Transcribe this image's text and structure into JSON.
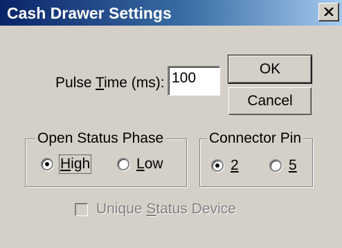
{
  "window": {
    "title": "Cash Drawer Settings"
  },
  "icons": {
    "close": "close-icon"
  },
  "pulse_time": {
    "label_prefix": "Pulse ",
    "label_mnemonic": "T",
    "label_suffix": "ime (ms):",
    "value": "100"
  },
  "buttons": {
    "ok": "OK",
    "cancel": "Cancel"
  },
  "open_status_phase": {
    "legend": "Open Status Phase",
    "options": [
      {
        "mnemonic": "H",
        "rest": "igh",
        "checked": true,
        "focused": true
      },
      {
        "mnemonic": "L",
        "rest": "ow",
        "checked": false,
        "focused": false
      }
    ]
  },
  "connector_pin": {
    "legend": "Connector Pin",
    "options": [
      {
        "mnemonic": "2",
        "rest": "",
        "checked": true
      },
      {
        "mnemonic": "5",
        "rest": "",
        "checked": false
      }
    ]
  },
  "unique_status_device": {
    "prefix": "Unique ",
    "mnemonic": "S",
    "suffix": "tatus Device",
    "checked": false,
    "enabled": false
  }
}
